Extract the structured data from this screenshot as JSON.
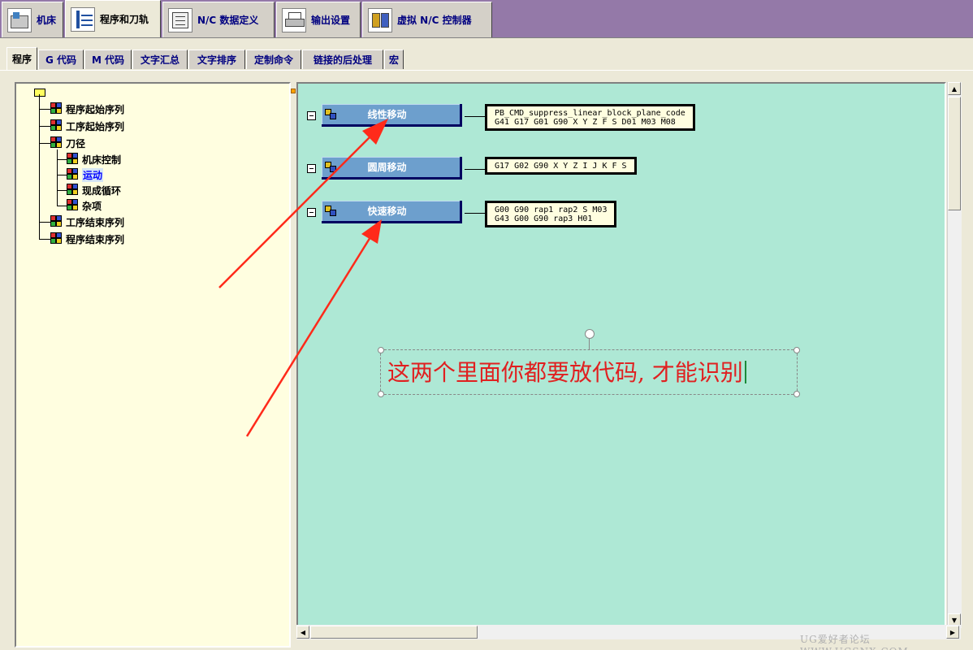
{
  "top_tabs": [
    {
      "label": "机床",
      "icon": "machine-icon"
    },
    {
      "label": "程序和刀轨",
      "icon": "program-toolpath-icon"
    },
    {
      "label": "N/C 数据定义",
      "icon": "nc-data-icon"
    },
    {
      "label": "输出设置",
      "icon": "printer-icon"
    },
    {
      "label": "虚拟 N/C 控制器",
      "icon": "virtual-controller-icon"
    }
  ],
  "sub_tabs": [
    "程序",
    "G 代码",
    "M 代码",
    "文字汇总",
    "文字排序",
    "定制命令",
    "链接的后处理",
    "宏"
  ],
  "tree": {
    "items": [
      {
        "label": "程序起始序列"
      },
      {
        "label": "工序起始序列"
      },
      {
        "label": "刀径"
      },
      {
        "label": "机床控制"
      },
      {
        "label": "运动"
      },
      {
        "label": "现成循环"
      },
      {
        "label": "杂项"
      },
      {
        "label": "工序结束序列"
      },
      {
        "label": "程序结束序列"
      }
    ]
  },
  "events": [
    {
      "label": "线性移动",
      "code": [
        "PB_CMD_suppress_linear_block_plane_code",
        "G41 G17 G01 G90 X Y Z F S D01 M03 M08"
      ]
    },
    {
      "label": "圆周移动",
      "code": [
        "G17 G02 G90 X Y Z I J K F S"
      ]
    },
    {
      "label": "快速移动",
      "code": [
        "G00 G90 rap1 rap2 S M03",
        "G43 G00 G90 rap3 H01"
      ]
    }
  ],
  "annotation": {
    "text": "这两个里面你都要放代码, 才能识别",
    "color": "#e02020"
  },
  "colors": {
    "canvas_bg": "#aee8d5",
    "tree_bg": "#fffee0",
    "event_button": "#6d9fcd",
    "top_bar": "#9479a8",
    "arrow": "#ff2a1a"
  },
  "watermark": "UG爱好者论坛 WWW.UGSNX.COM"
}
